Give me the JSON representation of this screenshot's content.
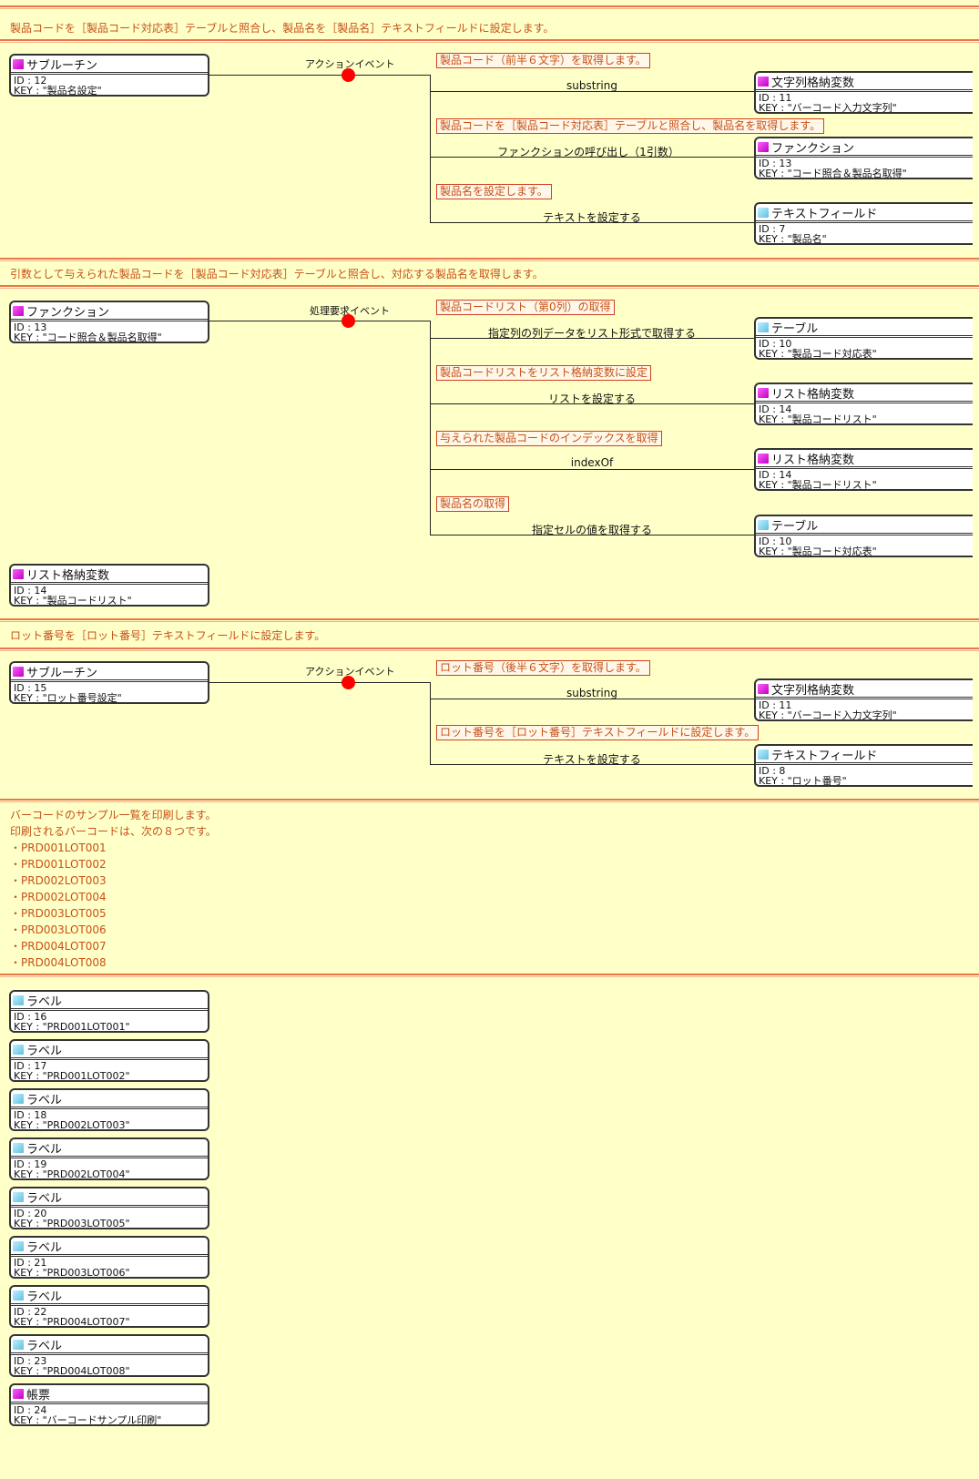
{
  "section1": {
    "title": "製品コードを［製品コード対応表］テーブルと照合し、製品名を［製品名］テキストフィールドに設定します。",
    "source": {
      "type": "サブルーチン",
      "id": "ID : 12",
      "key": "KEY : \"製品名設定\""
    },
    "event": "アクションイベント",
    "steps": [
      {
        "note": "製品コード（前半６文字）を取得します。",
        "action": "substring",
        "target": {
          "type": "文字列格納変数",
          "id": "ID : 11",
          "key": "KEY : \"バーコード入力文字列\""
        }
      },
      {
        "note": "製品コードを［製品コード対応表］テーブルと照合し、製品名を取得します。",
        "action": "ファンクションの呼び出し（1引数）",
        "target": {
          "type": "ファンクション",
          "id": "ID : 13",
          "key": "KEY : \"コード照合＆製品名取得\""
        }
      },
      {
        "note": "製品名を設定します。",
        "action": "テキストを設定する",
        "target": {
          "type": "テキストフィールド",
          "id": "ID : 7",
          "key": "KEY : \"製品名\""
        }
      }
    ]
  },
  "section2": {
    "title": "引数として与えられた製品コードを［製品コード対応表］テーブルと照合し、対応する製品名を取得します。",
    "source": {
      "type": "ファンクション",
      "id": "ID : 13",
      "key": "KEY : \"コード照合＆製品名取得\""
    },
    "event": "処理要求イベント",
    "steps": [
      {
        "note": "製品コードリスト（第0列）の取得",
        "action": "指定列の列データをリスト形式で取得する",
        "target": {
          "type": "テーブル",
          "id": "ID : 10",
          "key": "KEY : \"製品コード対応表\""
        }
      },
      {
        "note": "製品コードリストをリスト格納変数に設定",
        "action": "リストを設定する",
        "target": {
          "type": "リスト格納変数",
          "id": "ID : 14",
          "key": "KEY : \"製品コードリスト\""
        }
      },
      {
        "note": "与えられた製品コードのインデックスを取得",
        "action": "indexOf",
        "target": {
          "type": "リスト格納変数",
          "id": "ID : 14",
          "key": "KEY : \"製品コードリスト\""
        }
      },
      {
        "note": "製品名の取得",
        "action": "指定セルの値を取得する",
        "target": {
          "type": "テーブル",
          "id": "ID : 10",
          "key": "KEY : \"製品コード対応表\""
        }
      }
    ],
    "extra": {
      "type": "リスト格納変数",
      "id": "ID : 14",
      "key": "KEY : \"製品コードリスト\""
    }
  },
  "section3": {
    "title": "ロット番号を［ロット番号］テキストフィールドに設定します。",
    "source": {
      "type": "サブルーチン",
      "id": "ID : 15",
      "key": "KEY : \"ロット番号設定\""
    },
    "event": "アクションイベント",
    "steps": [
      {
        "note": "ロット番号（後半６文字）を取得します。",
        "action": "substring",
        "target": {
          "type": "文字列格納変数",
          "id": "ID : 11",
          "key": "KEY : \"バーコード入力文字列\""
        }
      },
      {
        "note": "ロット番号を［ロット番号］テキストフィールドに設定します。",
        "action": "テキストを設定する",
        "target": {
          "type": "テキストフィールド",
          "id": "ID : 8",
          "key": "KEY : \"ロット番号\""
        }
      }
    ]
  },
  "section4": {
    "lines": [
      "バーコードのサンプル一覧を印刷します。",
      "印刷されるバーコードは、次の８つです。",
      "・PRD001LOT001",
      "・PRD001LOT002",
      "・PRD002LOT003",
      "・PRD002LOT004",
      "・PRD003LOT005",
      "・PRD003LOT006",
      "・PRD004LOT007",
      "・PRD004LOT008"
    ],
    "nodes": [
      {
        "type": "ラベル",
        "id": "ID : 16",
        "key": "KEY : \"PRD001LOT001\""
      },
      {
        "type": "ラベル",
        "id": "ID : 17",
        "key": "KEY : \"PRD001LOT002\""
      },
      {
        "type": "ラベル",
        "id": "ID : 18",
        "key": "KEY : \"PRD002LOT003\""
      },
      {
        "type": "ラベル",
        "id": "ID : 19",
        "key": "KEY : \"PRD002LOT004\""
      },
      {
        "type": "ラベル",
        "id": "ID : 20",
        "key": "KEY : \"PRD003LOT005\""
      },
      {
        "type": "ラベル",
        "id": "ID : 21",
        "key": "KEY : \"PRD003LOT006\""
      },
      {
        "type": "ラベル",
        "id": "ID : 22",
        "key": "KEY : \"PRD004LOT007\""
      },
      {
        "type": "ラベル",
        "id": "ID : 23",
        "key": "KEY : \"PRD004LOT008\""
      },
      {
        "type": "帳票",
        "id": "ID : 24",
        "key": "KEY : \"バーコードサンプル印刷\""
      }
    ]
  }
}
